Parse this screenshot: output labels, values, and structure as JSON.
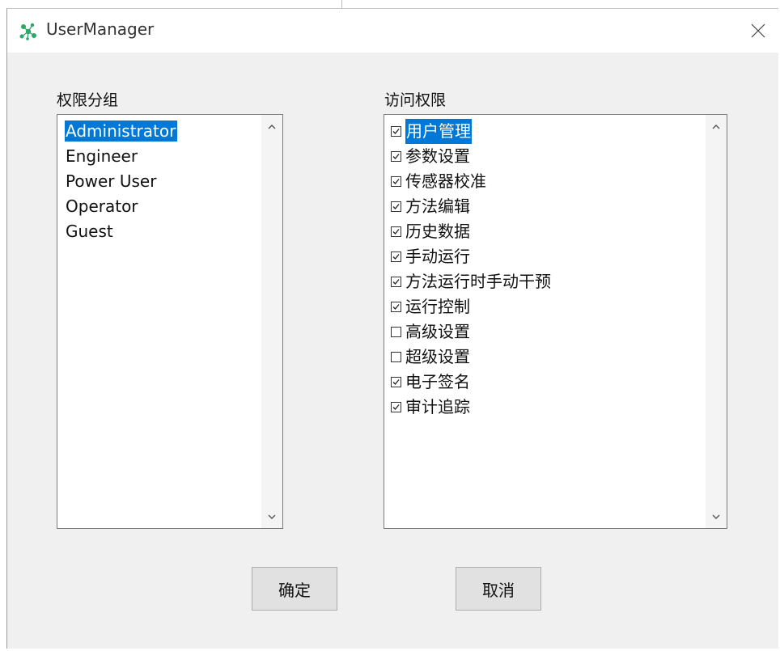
{
  "window": {
    "title": "UserManager",
    "icon": "app-network-icon",
    "close_icon": "close-icon"
  },
  "groups": {
    "label": "权限分组",
    "items": [
      {
        "label": "Administrator",
        "selected": true
      },
      {
        "label": "Engineer",
        "selected": false
      },
      {
        "label": "Power User",
        "selected": false
      },
      {
        "label": "Operator",
        "selected": false
      },
      {
        "label": "Guest",
        "selected": false
      }
    ]
  },
  "permissions": {
    "label": "访问权限",
    "items": [
      {
        "label": "用户管理",
        "checked": true,
        "selected": true
      },
      {
        "label": "参数设置",
        "checked": true,
        "selected": false
      },
      {
        "label": "传感器校准",
        "checked": true,
        "selected": false
      },
      {
        "label": "方法编辑",
        "checked": true,
        "selected": false
      },
      {
        "label": "历史数据",
        "checked": true,
        "selected": false
      },
      {
        "label": "手动运行",
        "checked": true,
        "selected": false
      },
      {
        "label": "方法运行时手动干预",
        "checked": true,
        "selected": false
      },
      {
        "label": "运行控制",
        "checked": true,
        "selected": false
      },
      {
        "label": "高级设置",
        "checked": false,
        "selected": false
      },
      {
        "label": "超级设置",
        "checked": false,
        "selected": false
      },
      {
        "label": "电子签名",
        "checked": true,
        "selected": false
      },
      {
        "label": "审计追踪",
        "checked": true,
        "selected": false
      }
    ]
  },
  "buttons": {
    "ok_label": "确定",
    "cancel_label": "取消"
  },
  "colors": {
    "selection": "#0078d7",
    "window_bg": "#f0f0f0",
    "button_bg": "#e1e1e1",
    "icon_green": "#2aa86a"
  }
}
